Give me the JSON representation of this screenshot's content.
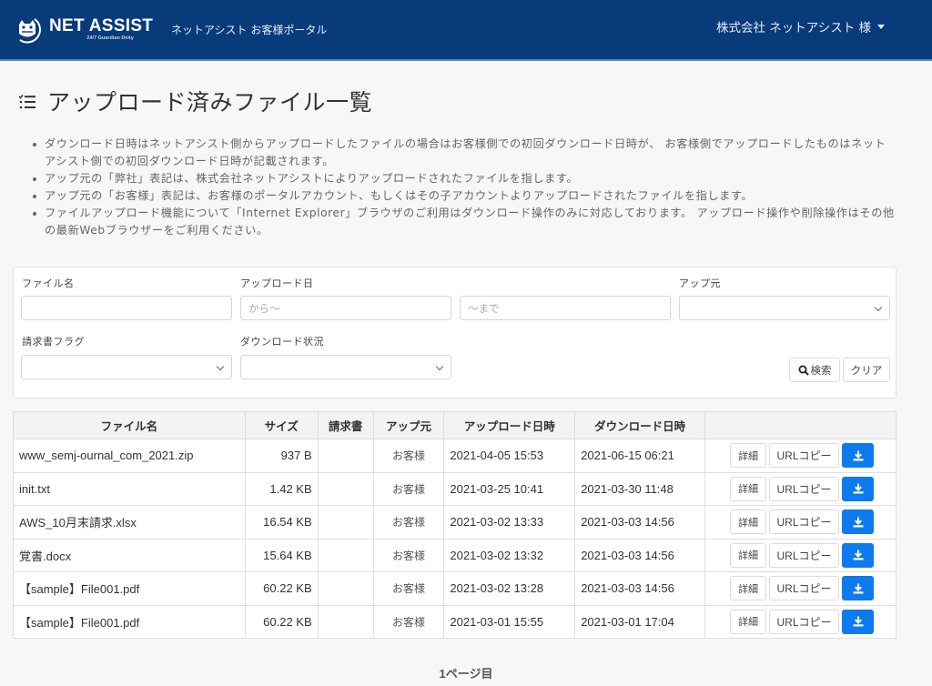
{
  "header": {
    "brand_name": "NET ASSIST",
    "brand_tagline": "24/7 Guardian Deity",
    "portal_name": "ネットアシスト お客様ポータル",
    "user_label": "株式会社 ネットアシスト 様",
    "colors": {
      "navbar_bg": "#083b7a",
      "accent": "#0d7af0"
    }
  },
  "page": {
    "title": "アップロード済みファイル一覧",
    "notes": [
      "ダウンロード日時はネットアシスト側からアップロードしたファイルの場合はお客様側での初回ダウンロード日時が、 お客様側でアップロードしたものはネットアシスト側での初回ダウンロード日時が記載されます。",
      "アップ元の「弊社」表記は、株式会社ネットアシストによりアップロードされたファイルを指します。",
      "アップ元の「お客様」表記は、お客様のポータルアカウント、もしくはその子アカウントよりアップロードされたファイルを指します。",
      "ファイルアップロード機能について「Internet Explorer」ブラウザのご利用はダウンロード操作のみに対応しております。 アップロード操作や削除操作はその他の最新Webブラウザーをご利用ください。"
    ]
  },
  "filters": {
    "file_name_label": "ファイル名",
    "file_name_value": "",
    "upload_date_label": "アップロード日",
    "upload_from_placeholder": "から〜",
    "upload_to_placeholder": "〜まで",
    "uploader_label": "アップ元",
    "uploader_value": "",
    "invoice_flag_label": "請求書フラグ",
    "invoice_flag_value": "",
    "download_status_label": "ダウンロード状況",
    "download_status_value": "",
    "search_button": "検索",
    "clear_button": "クリア"
  },
  "table": {
    "columns": [
      "ファイル名",
      "サイズ",
      "請求書",
      "アップ元",
      "アップロード日時",
      "ダウンロード日時",
      ""
    ],
    "detail_label": "詳細",
    "url_copy_label": "URLコピー",
    "rows": [
      {
        "file_name": "www_semj-ournal_com_2021.zip",
        "size": "937 B",
        "invoice": "",
        "uploader": "お客様",
        "uploaded_at": "2021-04-05 15:53",
        "downloaded_at": "2021-06-15 06:21"
      },
      {
        "file_name": "init.txt",
        "size": "1.42 KB",
        "invoice": "",
        "uploader": "お客様",
        "uploaded_at": "2021-03-25 10:41",
        "downloaded_at": "2021-03-30 11:48"
      },
      {
        "file_name": "AWS_10月末請求.xlsx",
        "size": "16.54 KB",
        "invoice": "",
        "uploader": "お客様",
        "uploaded_at": "2021-03-02 13:33",
        "downloaded_at": "2021-03-03 14:56"
      },
      {
        "file_name": "覚書.docx",
        "size": "15.64 KB",
        "invoice": "",
        "uploader": "お客様",
        "uploaded_at": "2021-03-02 13:32",
        "downloaded_at": "2021-03-03 14:56"
      },
      {
        "file_name": "【sample】File001.pdf",
        "size": "60.22 KB",
        "invoice": "",
        "uploader": "お客様",
        "uploaded_at": "2021-03-02 13:28",
        "downloaded_at": "2021-03-03 14:56"
      },
      {
        "file_name": "【sample】File001.pdf",
        "size": "60.22 KB",
        "invoice": "",
        "uploader": "お客様",
        "uploaded_at": "2021-03-01 15:55",
        "downloaded_at": "2021-03-01 17:04"
      }
    ]
  },
  "pagination": {
    "current_page_label": "1ページ目"
  }
}
